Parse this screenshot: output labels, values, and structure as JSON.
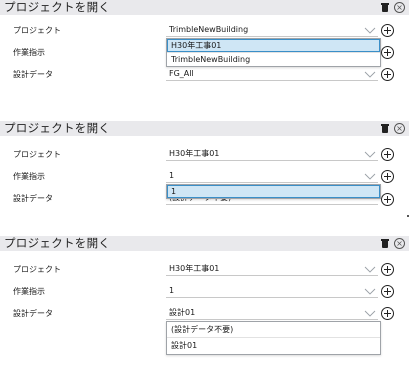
{
  "panels": [
    {
      "title": "プロジェクトを開く",
      "rows": [
        {
          "label": "プロジェクト",
          "value": "TrimbleNewBuilding"
        },
        {
          "label": "作業指示",
          "value": ""
        },
        {
          "label": "設計データ",
          "value": "FG_All"
        }
      ],
      "dropdown": {
        "options": [
          "H30年工事01",
          "TrimbleNewBuilding"
        ],
        "selected_index": 0
      }
    },
    {
      "title": "プロジェクトを開く",
      "rows": [
        {
          "label": "プロジェクト",
          "value": "H30年工事01"
        },
        {
          "label": "作業指示",
          "value": "1"
        },
        {
          "label": "設計データ",
          "value": "(設計データ不要)"
        }
      ],
      "dropdown": {
        "options": [
          "1"
        ],
        "selected_index": 0
      }
    },
    {
      "title": "プロジェクトを開く",
      "rows": [
        {
          "label": "プロジェクト",
          "value": "H30年工事01"
        },
        {
          "label": "作業指示",
          "value": "1"
        },
        {
          "label": "設計データ",
          "value": "設計01"
        }
      ],
      "dropdown": {
        "options": [
          "(設計データ不要)",
          "設計01"
        ],
        "selected_index": -1
      }
    }
  ],
  "icons": {
    "delete": "trash-icon",
    "close": "close-circle-icon",
    "expand": "chevron-down-icon",
    "add": "plus-circle-icon"
  },
  "colors": {
    "header_bg": "#e9e9ec",
    "selected_option_bg": "#cfe6f5",
    "selected_option_border": "#3a8fc8"
  }
}
